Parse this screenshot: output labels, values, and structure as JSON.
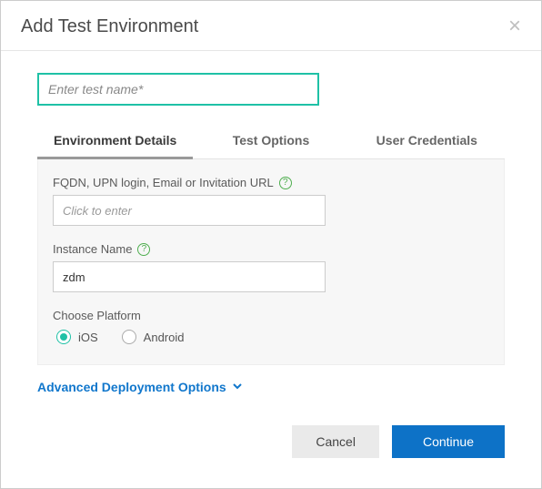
{
  "header": {
    "title": "Add Test Environment"
  },
  "testName": {
    "value": "",
    "placeholder": "Enter test name*"
  },
  "tabs": [
    {
      "label": "Environment Details"
    },
    {
      "label": "Test Options"
    },
    {
      "label": "User Credentials"
    }
  ],
  "fields": {
    "fqdn": {
      "label": "FQDN, UPN login, Email or Invitation URL",
      "value": "",
      "placeholder": "Click to enter"
    },
    "instanceName": {
      "label": "Instance Name",
      "value": "zdm"
    },
    "platform": {
      "label": "Choose Platform",
      "options": {
        "ios": "iOS",
        "android": "Android"
      },
      "selected": "ios"
    }
  },
  "advanced": {
    "label": "Advanced Deployment Options"
  },
  "buttons": {
    "cancel": "Cancel",
    "continue": "Continue"
  }
}
